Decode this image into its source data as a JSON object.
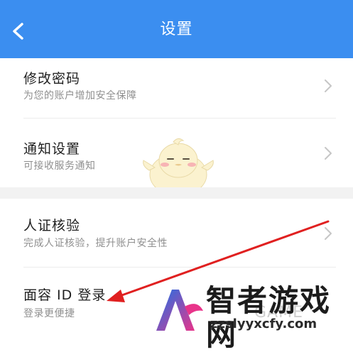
{
  "header": {
    "title": "设置",
    "back_icon": "chevron-left-icon",
    "bg_color": "#3b8ef0"
  },
  "settings": [
    {
      "title": "修改密码",
      "subtitle": "为您的账户增加安全保障"
    },
    {
      "title": "通知设置",
      "subtitle": "可接收服务通知"
    },
    {
      "title": "人证核验",
      "subtitle": "完成人证核验，提升账户安全性"
    },
    {
      "title": "面容 ID 登录",
      "subtitle": "登录更便捷"
    }
  ],
  "annotation": {
    "arrow_color": "#e02020"
  },
  "watermark": {
    "brand": "智者游戏网",
    "url": "zzslyyxcfy.com",
    "game_text": "GAME"
  }
}
